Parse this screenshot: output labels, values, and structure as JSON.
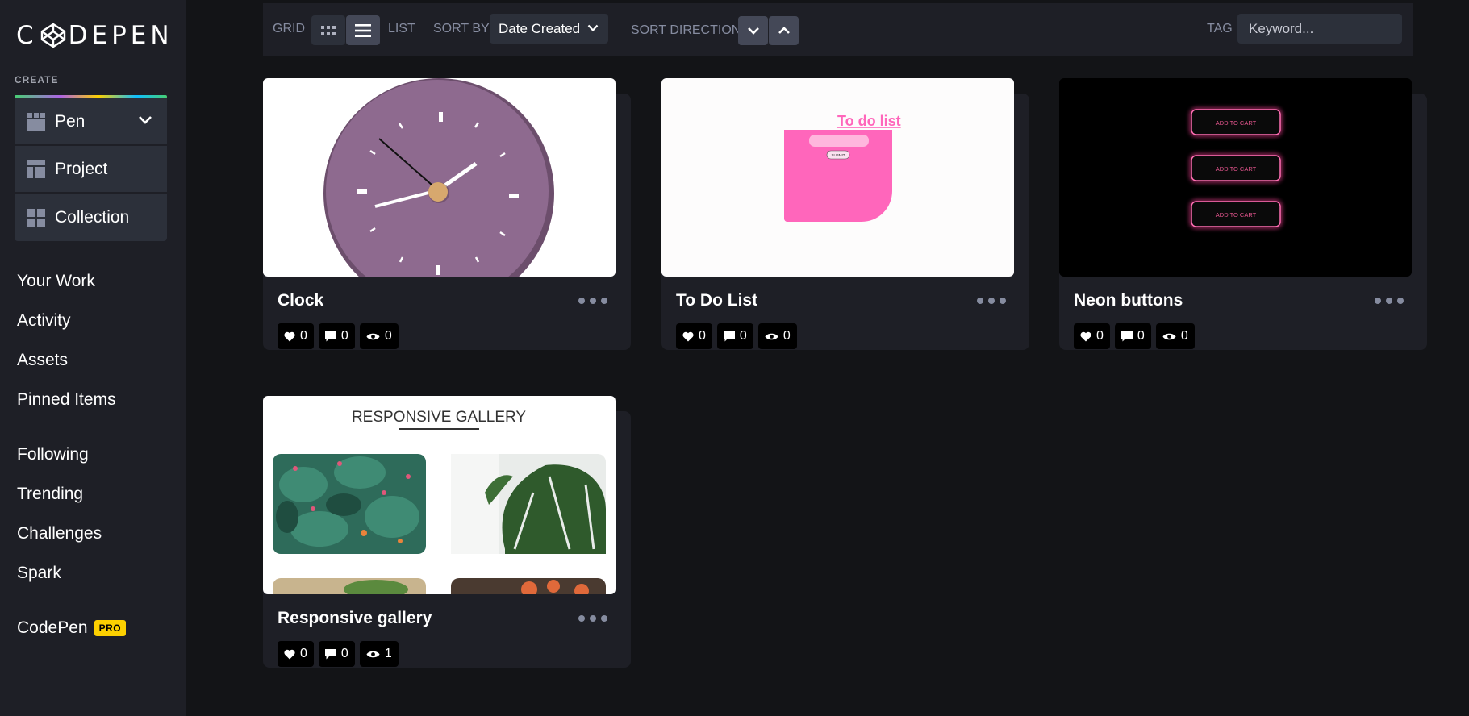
{
  "logo": {
    "text": "C DEPEN"
  },
  "sidebar": {
    "create_label": "CREATE",
    "create_items": [
      {
        "label": "Pen",
        "icon": "pen-icon"
      },
      {
        "label": "Project",
        "icon": "project-icon"
      },
      {
        "label": "Collection",
        "icon": "collection-icon"
      }
    ],
    "nav_primary": [
      "Your Work",
      "Activity",
      "Assets",
      "Pinned Items"
    ],
    "nav_secondary": [
      "Following",
      "Trending",
      "Challenges",
      "Spark"
    ],
    "codepen_label": "CodePen",
    "pro_badge": "PRO"
  },
  "toolbar": {
    "grid_label": "GRID",
    "list_label": "LIST",
    "sort_by_label": "SORT BY",
    "sort_by_value": "Date Created",
    "sort_direction_label": "SORT DIRECTION",
    "tag_label": "TAG",
    "tag_placeholder": "Keyword..."
  },
  "cards": [
    {
      "title": "Clock",
      "likes": "0",
      "comments": "0",
      "views": "0"
    },
    {
      "title": "To Do List",
      "likes": "0",
      "comments": "0",
      "views": "0",
      "thumb_title": "To do list",
      "thumb_button": "SUBMIT"
    },
    {
      "title": "Neon buttons",
      "likes": "0",
      "comments": "0",
      "views": "0",
      "thumb_buttons": [
        "ADD TO CART",
        "ADD TO CART",
        "ADD TO CART"
      ]
    },
    {
      "title": "Responsive gallery",
      "likes": "0",
      "comments": "0",
      "views": "1",
      "thumb_title": "RESPONSIVE GALLERY"
    }
  ],
  "colors": {
    "accent_yellow": "#fcd000",
    "bg": "#131417",
    "panel": "#1e1f26",
    "clock_face": "#8e6a8f",
    "todo_pink": "#ff66bb"
  }
}
